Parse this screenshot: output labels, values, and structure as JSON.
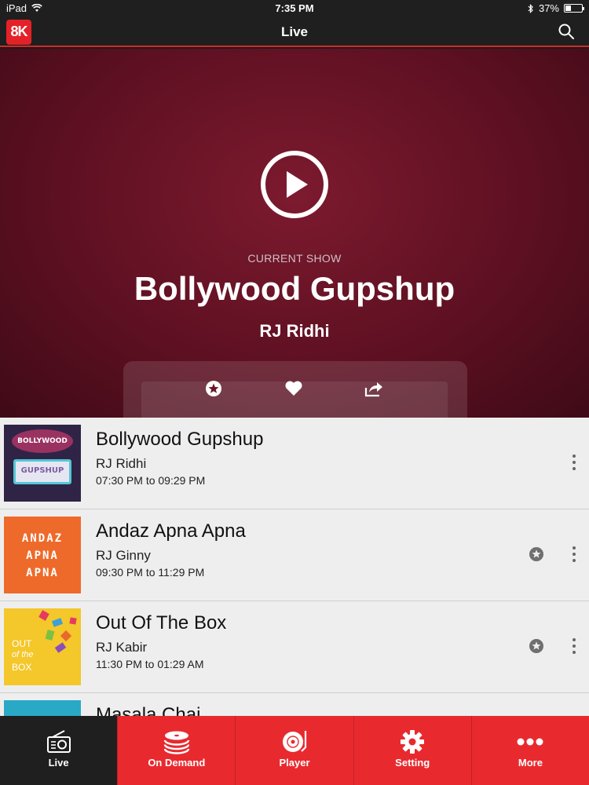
{
  "status_bar": {
    "device": "iPad",
    "time": "7:35 PM",
    "battery": "37%",
    "battery_level": 0.37
  },
  "nav": {
    "logo_text": "8K",
    "title": "Live"
  },
  "hero": {
    "label": "CURRENT SHOW",
    "title": "Bollywood Gupshup",
    "rj": "RJ Ridhi"
  },
  "shows": [
    {
      "title": "Bollywood Gupshup",
      "rj": "RJ Ridhi",
      "time": "07:30 PM to 09:29 PM",
      "thumb_text": [
        "BOLLYWOOD",
        "GUPSHUP"
      ],
      "has_star": false
    },
    {
      "title": "Andaz Apna Apna",
      "rj": "RJ Ginny",
      "time": "09:30 PM to 11:29 PM",
      "thumb_text": [
        "ANDAZ",
        "APNA",
        "APNA"
      ],
      "has_star": true
    },
    {
      "title": "Out Of The Box",
      "rj": "RJ Kabir",
      "time": "11:30 PM to 01:29 AM",
      "thumb_text": [
        "OUT",
        "of the",
        "BOX"
      ],
      "has_star": true
    },
    {
      "title": "Masala Chai"
    }
  ],
  "tabs": [
    {
      "label": "Live",
      "icon": "radio-icon"
    },
    {
      "label": "On Demand",
      "icon": "disc-stack-icon"
    },
    {
      "label": "Player",
      "icon": "turntable-icon"
    },
    {
      "label": "Setting",
      "icon": "gear-icon"
    },
    {
      "label": "More",
      "icon": "more-dots-icon"
    }
  ],
  "colors": {
    "brand_red": "#e82a2f",
    "hero_bg": "#6a1426",
    "active_tab": "#1f1f1f"
  }
}
